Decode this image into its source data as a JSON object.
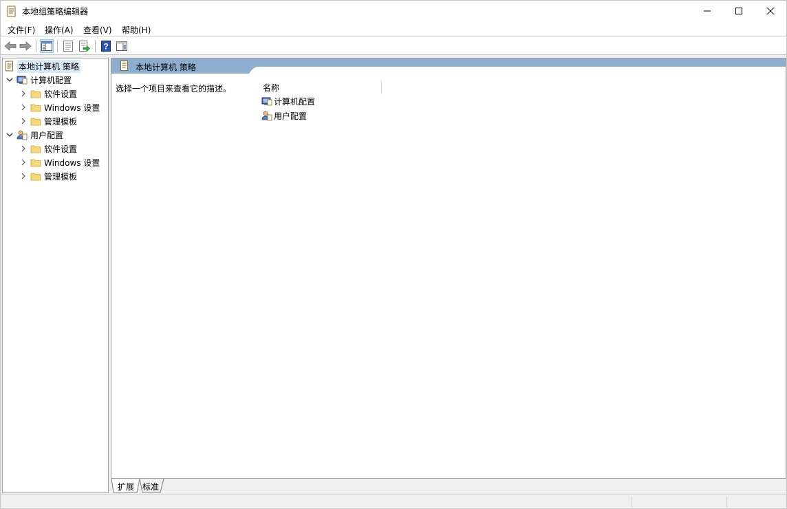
{
  "window": {
    "title": "本地组策略编辑器",
    "icon": "policy-document-icon"
  },
  "menu": [
    {
      "label": "文件(F)"
    },
    {
      "label": "操作(A)"
    },
    {
      "label": "查看(V)"
    },
    {
      "label": "帮助(H)"
    }
  ],
  "toolbar": {
    "buttons": [
      "back-arrow-icon",
      "forward-arrow-icon",
      "show-tree-icon",
      "properties-icon",
      "export-list-icon",
      "help-icon",
      "show-hide-action-pane-icon"
    ]
  },
  "tree": {
    "root": "本地计算机 策略",
    "computer_config": "计算机配置",
    "user_config": "用户配置",
    "software_settings": "软件设置",
    "windows_settings": "Windows 设置",
    "admin_templates": "管理模板"
  },
  "right_pane": {
    "header": "本地计算机 策略",
    "description": "选择一个项目来查看它的描述。",
    "column_name": "名称",
    "items": [
      {
        "label": "计算机配置"
      },
      {
        "label": "用户配置"
      }
    ]
  },
  "tabs": {
    "extended": "扩展",
    "standard": "标准"
  },
  "colors": {
    "header_blue": "#8eaed0",
    "selection": "#d9e9f7"
  }
}
